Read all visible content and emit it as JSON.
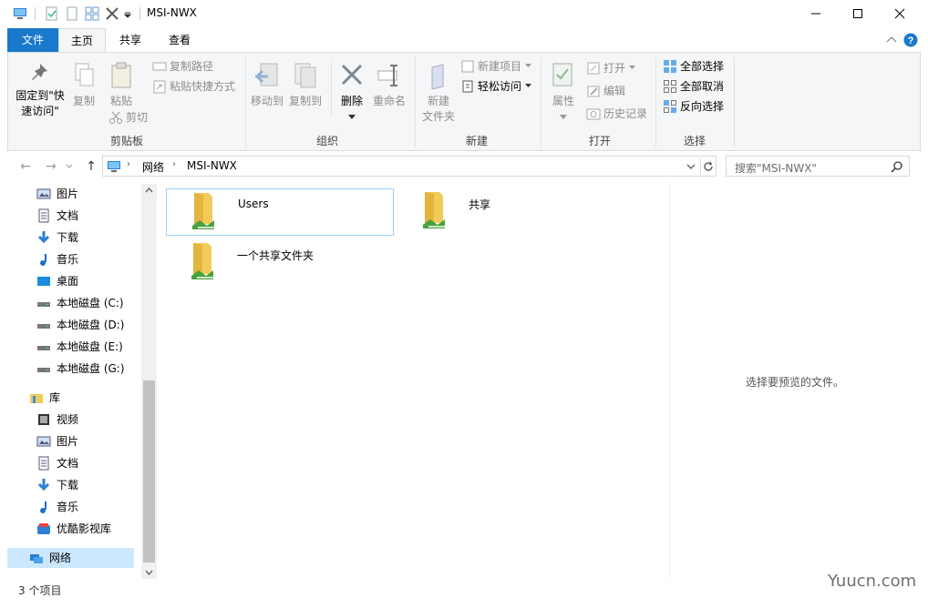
{
  "window": {
    "title": "MSI-NWX",
    "minimize_label": "",
    "maximize_label": "",
    "close_label": ""
  },
  "ribbon_tabs": {
    "file": "文件",
    "home": "主页",
    "share": "共享",
    "view": "查看"
  },
  "ribbon": {
    "clipboard": {
      "pin_line1": "固定到\"快",
      "pin_line2": "速访问\"",
      "copy": "复制",
      "paste": "粘贴",
      "copy_path": "复制路径",
      "paste_shortcut": "粘贴快捷方式",
      "cut": "剪切",
      "label": "剪贴板"
    },
    "organize": {
      "move_to": "移动到",
      "copy_to": "复制到",
      "delete": "删除",
      "rename": "重命名",
      "label": "组织"
    },
    "new": {
      "new_folder_line1": "新建",
      "new_folder_line2": "文件夹",
      "new_item": "新建项目",
      "easy_access": "轻松访问",
      "label": "新建"
    },
    "open": {
      "properties": "属性",
      "open": "打开",
      "edit": "编辑",
      "history": "历史记录",
      "label": "打开"
    },
    "select": {
      "select_all": "全部选择",
      "select_none": "全部取消",
      "invert": "反向选择",
      "label": "选择"
    }
  },
  "address": {
    "crumbs": [
      "网络",
      "MSI-NWX"
    ],
    "search_placeholder": "搜索\"MSI-NWX\""
  },
  "sidebar": {
    "items": [
      {
        "label": "图片",
        "icon": "pictures-icon"
      },
      {
        "label": "文档",
        "icon": "documents-icon"
      },
      {
        "label": "下载",
        "icon": "download-icon"
      },
      {
        "label": "音乐",
        "icon": "music-icon"
      },
      {
        "label": "桌面",
        "icon": "desktop-icon"
      },
      {
        "label": "本地磁盘 (C:)",
        "icon": "drive-icon"
      },
      {
        "label": "本地磁盘 (D:)",
        "icon": "drive-icon"
      },
      {
        "label": "本地磁盘 (E:)",
        "icon": "drive-icon"
      },
      {
        "label": "本地磁盘 (G:)",
        "icon": "drive-icon"
      },
      {
        "label": "库",
        "icon": "library-icon"
      },
      {
        "label": "视频",
        "icon": "video-icon"
      },
      {
        "label": "图片",
        "icon": "pictures-icon"
      },
      {
        "label": "文档",
        "icon": "documents-icon"
      },
      {
        "label": "下载",
        "icon": "download-icon"
      },
      {
        "label": "音乐",
        "icon": "music-icon"
      },
      {
        "label": "优酷影视库",
        "icon": "youku-icon"
      },
      {
        "label": "网络",
        "icon": "network-icon"
      }
    ]
  },
  "files": [
    {
      "name": "Users",
      "icon": "shared-folder-icon"
    },
    {
      "name": "共享",
      "icon": "shared-folder-icon"
    },
    {
      "name": "一个共享文件夹",
      "icon": "shared-folder-icon"
    }
  ],
  "preview": {
    "text": "选择要预览的文件。"
  },
  "status": {
    "count": "3 个项目"
  },
  "watermark": "Yuucn.com",
  "colors": {
    "accent": "#1979ca",
    "selection": "#cce8ff",
    "folder": "#f0c94a"
  }
}
